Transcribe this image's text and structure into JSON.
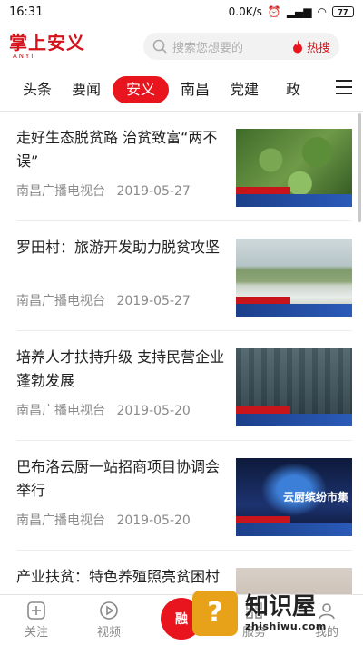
{
  "status_bar": {
    "time": "16:31",
    "speed": "0.0K/s",
    "battery": "77"
  },
  "header": {
    "logo_text": "掌上安义",
    "logo_sub": "ANYI",
    "search_placeholder": "搜索您想要的",
    "hot_search_label": "热搜"
  },
  "tabs": [
    {
      "label": "头条",
      "active": false
    },
    {
      "label": "要闻",
      "active": false
    },
    {
      "label": "安义",
      "active": true
    },
    {
      "label": "南昌",
      "active": false
    },
    {
      "label": "党建",
      "active": false
    },
    {
      "label": "政",
      "active": false
    }
  ],
  "articles": [
    {
      "title": "走好生态脱贫路 治贫致富“两不误”",
      "source": "南昌广播电视台",
      "date": "2019-05-27"
    },
    {
      "title": "罗田村：旅游开发助力脱贫攻坚",
      "source": "南昌广播电视台",
      "date": "2019-05-27"
    },
    {
      "title": "培养人才扶持升级  支持民营企业蓬勃发展",
      "source": "南昌广播电视台",
      "date": "2019-05-20"
    },
    {
      "title": "巴布洛云厨一站招商项目协调会举行",
      "source": "南昌广播电视台",
      "date": "2019-05-20",
      "thumb_text": "云厨缤纷市集"
    },
    {
      "title": "产业扶贫：特色养殖照亮贫困村",
      "source": "",
      "date": ""
    }
  ],
  "bottom_nav": [
    {
      "label": "关注",
      "icon": "plus-square-icon"
    },
    {
      "label": "视频",
      "icon": "play-circle-icon"
    },
    {
      "label": "融",
      "icon": "center-circle"
    },
    {
      "label": "服务",
      "icon": "grid-icon"
    },
    {
      "label": "我的",
      "icon": "user-icon"
    }
  ],
  "watermark": {
    "cn": "知识屋",
    "en": "zhishiwu.com"
  },
  "colors": {
    "brand_red": "#e8151e",
    "meta_gray": "#8a8a8a"
  }
}
